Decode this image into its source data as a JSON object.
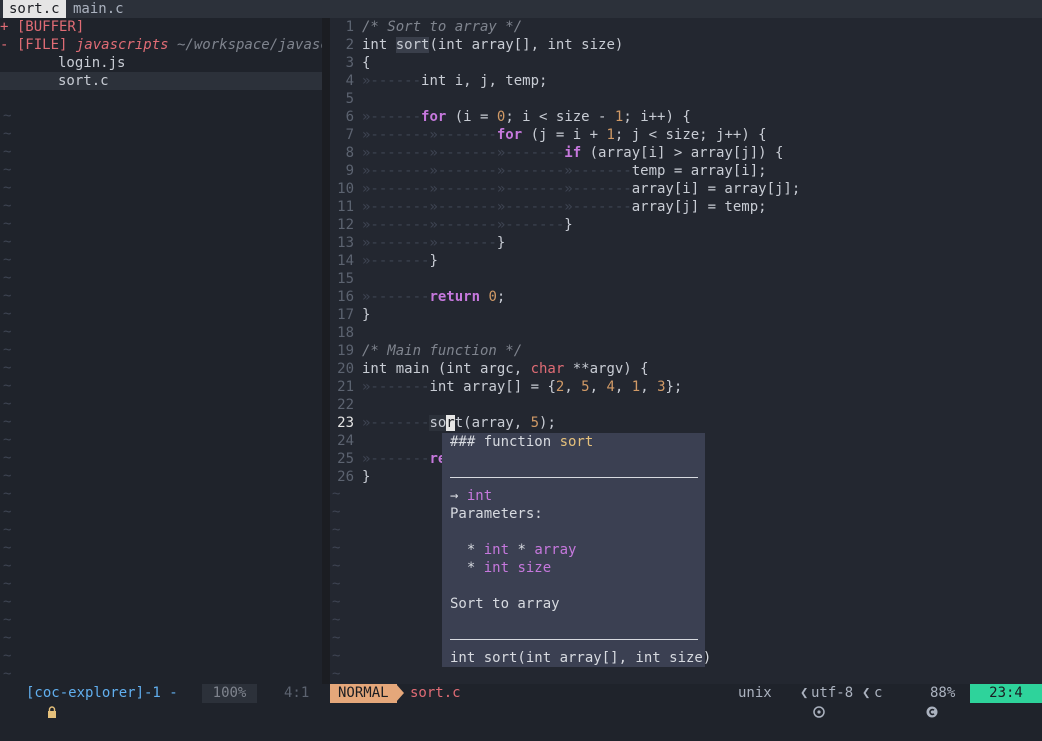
{
  "tabs": [
    {
      "label": "sort.c",
      "active": true
    },
    {
      "label": "main.c",
      "active": false
    }
  ],
  "explorer": {
    "buffer_row": "+ [BUFFER]",
    "file_row_prefix": "- [FILE] ",
    "file_row_folder": "javascripts",
    "file_row_path": " ~/workspace/javascr",
    "files": [
      "login.js",
      "sort.c"
    ],
    "selected_file": "sort.c"
  },
  "editor": {
    "lines": [
      {
        "n": "1"
      },
      {
        "n": "2"
      },
      {
        "n": "3"
      },
      {
        "n": "4"
      },
      {
        "n": "5"
      },
      {
        "n": "6"
      },
      {
        "n": "7"
      },
      {
        "n": "8"
      },
      {
        "n": "9"
      },
      {
        "n": "10"
      },
      {
        "n": "11"
      },
      {
        "n": "12"
      },
      {
        "n": "13"
      },
      {
        "n": "14"
      },
      {
        "n": "15"
      },
      {
        "n": "16"
      },
      {
        "n": "17"
      },
      {
        "n": "18"
      },
      {
        "n": "19"
      },
      {
        "n": "20"
      },
      {
        "n": "21"
      },
      {
        "n": "22"
      },
      {
        "n": "23"
      },
      {
        "n": "24"
      },
      {
        "n": "25"
      },
      {
        "n": "26"
      }
    ],
    "code": {
      "l1": "/* Sort to array */",
      "l2_int": "int ",
      "l2_fn": "sort",
      "l2_rest_a": "(int array[], int size)",
      "l3": "{",
      "l4": "int i, j, temp;",
      "l6_kw": "for",
      "l6_a": " (i = ",
      "l6_n0": "0",
      "l6_b": "; i < size - ",
      "l6_n1": "1",
      "l6_c": "; i++) {",
      "l7_kw": "for",
      "l7_a": " (j = i + ",
      "l7_n1": "1",
      "l7_b": "; j < size; j++) {",
      "l8_kw": "if",
      "l8_a": " (array[i] > array[j]) {",
      "l9": "temp = array[i];",
      "l10": "array[i] = array[j];",
      "l11": "array[j] = temp;",
      "l12": "}",
      "l13": "}",
      "l14": "}",
      "l16_kw": "return",
      "l16_n": "0",
      "l16_end": ";",
      "l17": "}",
      "l19": "/* Main function */",
      "l20_a": "int main (int argc, ",
      "l20_kw": "char",
      "l20_b": " **argv) {",
      "l21_a": "int array[] = {",
      "l21_n1": "2",
      "l21_n2": "5",
      "l21_n3": "4",
      "l21_n4": "1",
      "l21_n5": "3",
      "l21_b": "};",
      "l23_a": "so",
      "l23_cur": "r",
      "l23_b": "t(array, ",
      "l23_n": "5",
      "l23_c": ");",
      "l25_kw": "re",
      "l26": "}"
    }
  },
  "popup": {
    "header_a": "### function ",
    "header_fn": "sort",
    "ret_arrow": "→ ",
    "ret_type": "int",
    "params_label": "Parameters:",
    "param1_bullet": "  * ",
    "param1_type": "int",
    "param1_rest": " * ",
    "param1_name": "array",
    "param2_bullet": "  * ",
    "param2_type": "int",
    "param2_name": " size",
    "description": "Sort to array",
    "signature": "int sort(int array[], int size)"
  },
  "statusline": {
    "explorer_lock": "🔒",
    "explorer_label": "[coc-explorer]-1 -",
    "explorer_percent": "100%",
    "explorer_pos": "4:1",
    "mode": "NORMAL",
    "filename": "sort.c",
    "fileformat": "unix",
    "encoding": "utf-8",
    "filetype": "c",
    "percent": "88%",
    "position": "23:4"
  },
  "colors": {
    "background": "#232730",
    "mode_bg": "#e5a77a",
    "position_bg": "#2ed39b",
    "keyword": "#c678dd",
    "number": "#d19a66",
    "comment": "#7f848e",
    "accent_red": "#e06c75"
  }
}
